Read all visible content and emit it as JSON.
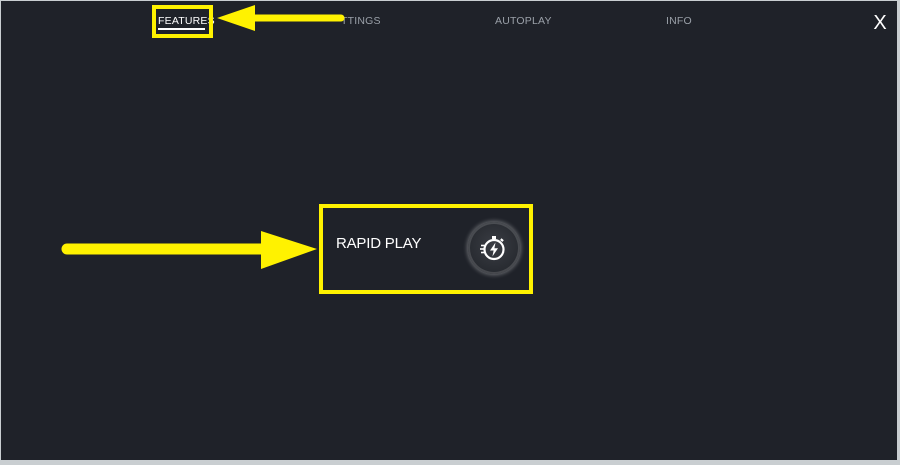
{
  "tabs": [
    {
      "label": "FEATURES",
      "active": true
    },
    {
      "label": "SETTINGS",
      "visible_label": "TTINGS",
      "active": false
    },
    {
      "label": "AUTOPLAY",
      "active": false
    },
    {
      "label": "INFO",
      "active": false
    }
  ],
  "close_label": "X",
  "features": {
    "rapid_play": {
      "label": "RAPID PLAY",
      "icon": "rapid-play-stopwatch-bolt-icon"
    }
  },
  "colors": {
    "background": "#1f2229",
    "highlight": "#fff200",
    "text_active": "#ffffff",
    "text_inactive": "#9aa0a8"
  }
}
